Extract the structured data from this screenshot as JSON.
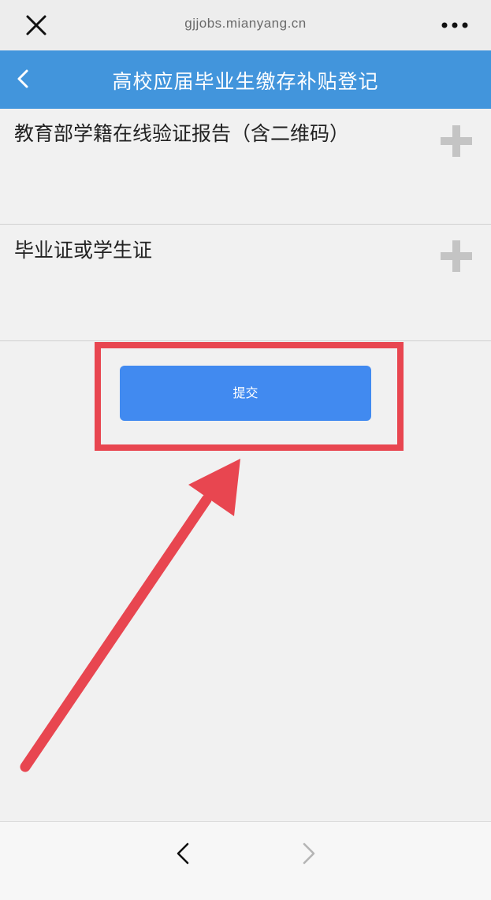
{
  "browser": {
    "url": "gjjobs.mianyang.cn",
    "close_icon": "close-icon",
    "more_icon": "more-icon"
  },
  "header": {
    "title": "高校应届毕业生缴存补贴登记",
    "back_icon": "chevron-left-icon",
    "background_color": "#4295dc"
  },
  "uploads": [
    {
      "label": "教育部学籍在线验证报告（含二维码）",
      "icon": "plus-icon"
    },
    {
      "label": "毕业证或学生证",
      "icon": "plus-icon"
    }
  ],
  "submit": {
    "label": "提交",
    "color": "#418af0"
  },
  "annotation": {
    "highlight_color": "#e84650"
  },
  "bottom_nav": {
    "back_icon": "chevron-left-icon",
    "forward_icon": "chevron-right-icon"
  }
}
